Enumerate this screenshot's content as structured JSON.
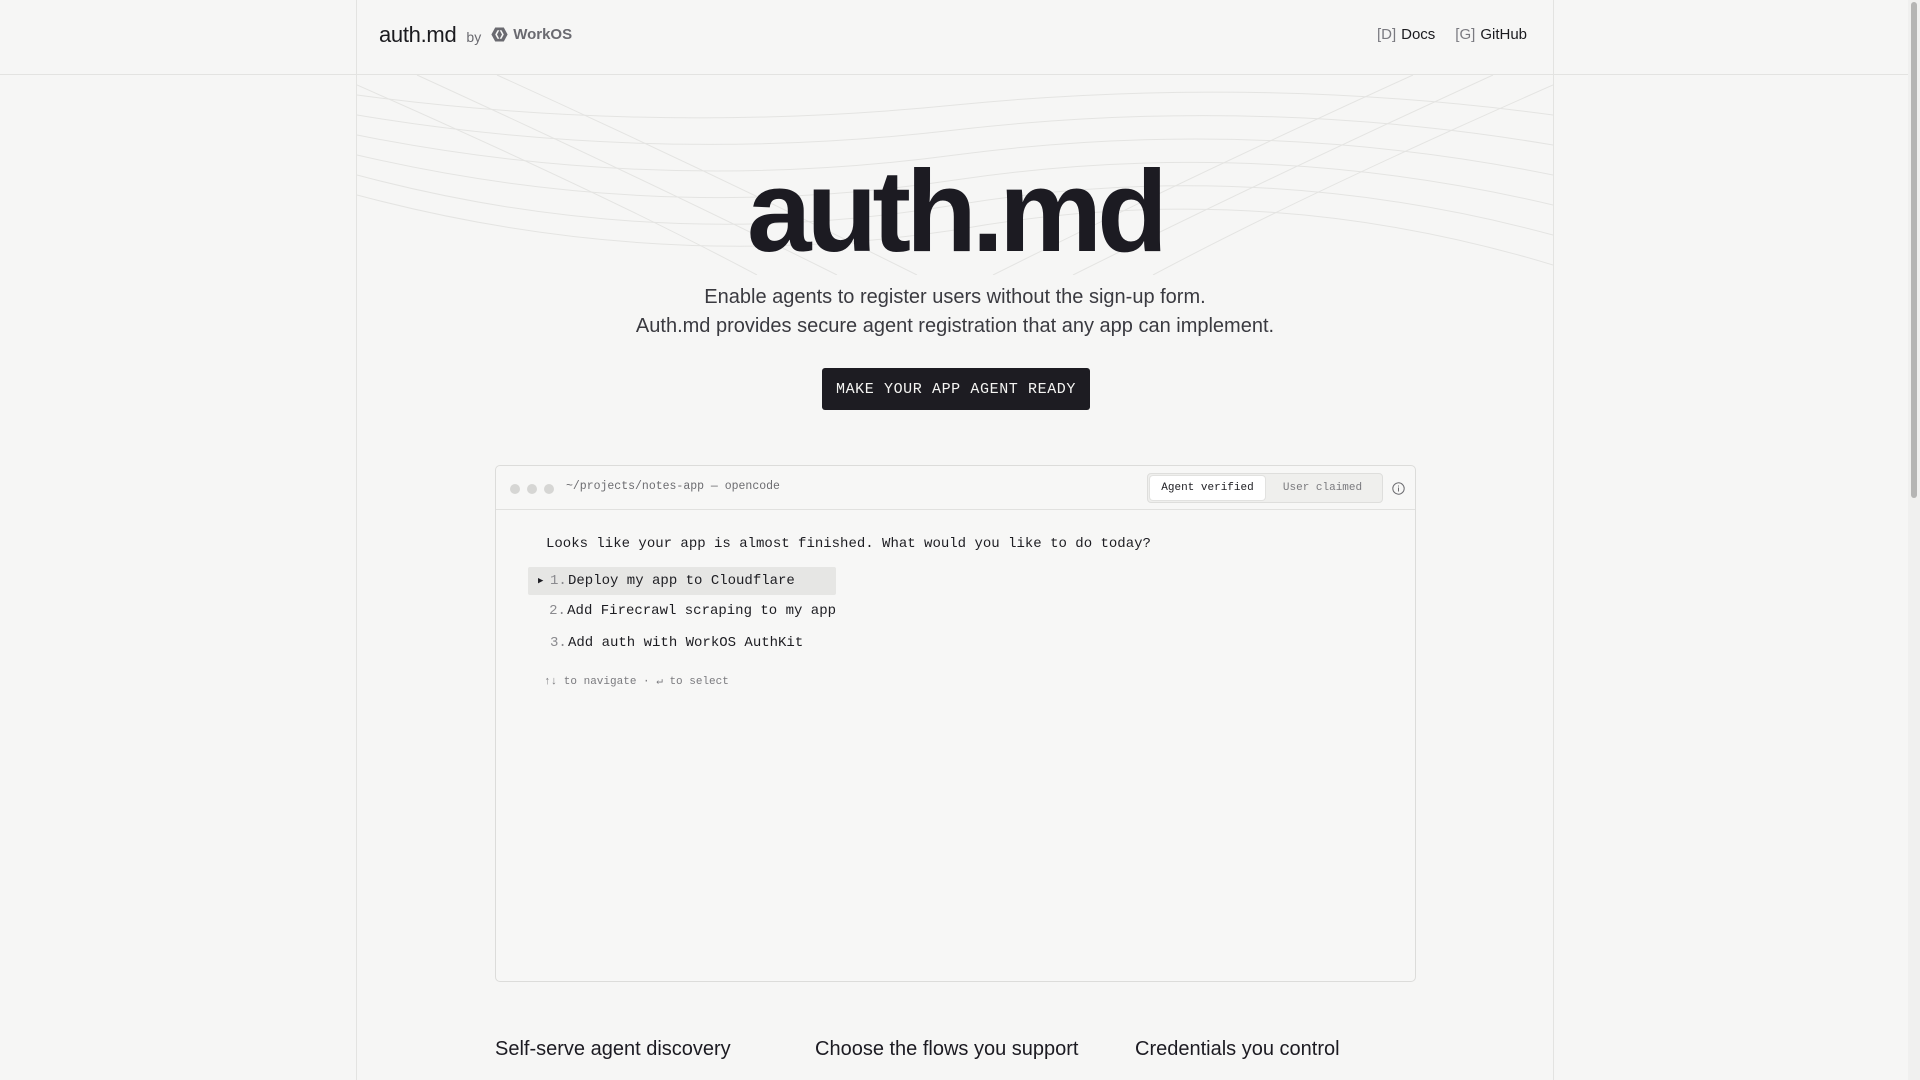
{
  "header": {
    "brand": "auth.md",
    "by": "by",
    "company": "WorkOS",
    "nav": [
      {
        "key": "[D]",
        "label": "Docs"
      },
      {
        "key": "[G]",
        "label": "GitHub"
      }
    ]
  },
  "hero": {
    "title": "auth.md",
    "subtitle_line1": "Enable agents to register users without the sign-up form.",
    "subtitle_line2": "Auth.md provides secure agent registration that any app can implement.",
    "cta": "MAKE YOUR APP AGENT READY"
  },
  "terminal": {
    "path": "~/projects/notes-app — opencode",
    "tabs": [
      {
        "label": "Agent verified",
        "active": true
      },
      {
        "label": "User claimed",
        "active": false
      }
    ],
    "prompt": "Looks like your app is almost finished. What would you like to do today?",
    "options": [
      {
        "num": "1.",
        "label": "Deploy my app to Cloudflare",
        "selected": true
      },
      {
        "num": "2.",
        "label": "Add Firecrawl scraping to my app",
        "selected": false
      },
      {
        "num": "3.",
        "label": "Add auth with WorkOS AuthKit",
        "selected": false
      }
    ],
    "hint": "↑↓ to navigate · ↵ to select"
  },
  "features": [
    {
      "title": "Self-serve agent discovery"
    },
    {
      "title": "Choose the flows you support"
    },
    {
      "title": "Credentials you control"
    }
  ],
  "colors": {
    "background": "#f6f6f5",
    "text": "#1b1b1f",
    "cta_bg": "#1d1c22",
    "border": "#e3e3e1"
  }
}
